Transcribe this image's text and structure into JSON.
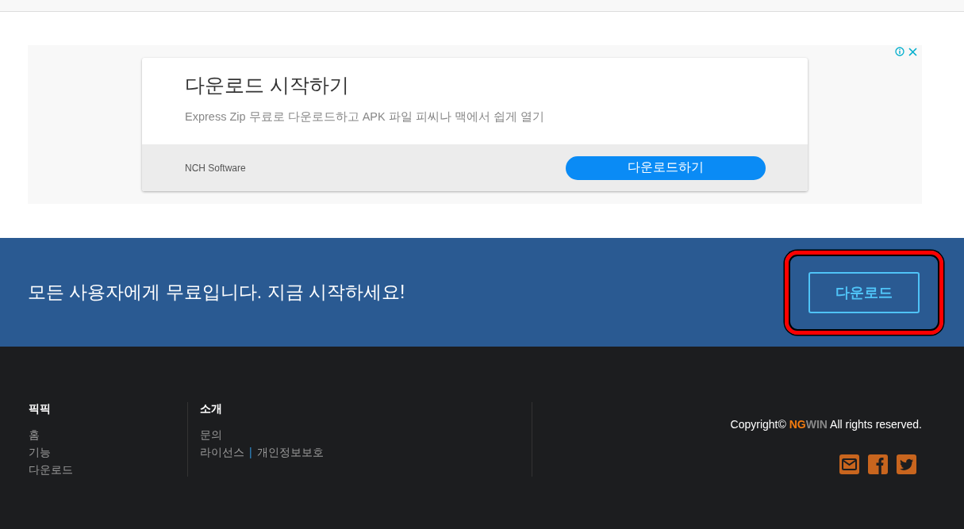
{
  "ad": {
    "title": "다운로드 시작하기",
    "description": "Express Zip 무료로 다운로드하고 APK 파일 피씨나 맥에서 쉽게 열기",
    "advertiser": "NCH Software",
    "button": "다운로드하기"
  },
  "banner": {
    "text": "모든 사용자에게 무료입니다. 지금 시작하세요!",
    "button": "다운로드",
    "highlighted": true
  },
  "footer": {
    "columns": [
      {
        "heading": "픽픽",
        "links": [
          [
            {
              "kind": "link",
              "text": "홈"
            }
          ],
          [
            {
              "kind": "link",
              "text": "기능"
            }
          ],
          [
            {
              "kind": "link",
              "text": "다운로드"
            }
          ]
        ]
      },
      {
        "heading": "소개",
        "links": [
          [
            {
              "kind": "link",
              "text": "문의"
            }
          ],
          [
            {
              "kind": "link",
              "text": "라이선스"
            },
            {
              "kind": "separator",
              "text": "|"
            },
            {
              "kind": "link",
              "text": "개인정보보호"
            }
          ]
        ]
      }
    ],
    "copyright": {
      "prefix": "Copyright©",
      "brand_accent": "NG",
      "brand_rest": "WIN",
      "suffix": "All rights reserved."
    }
  }
}
